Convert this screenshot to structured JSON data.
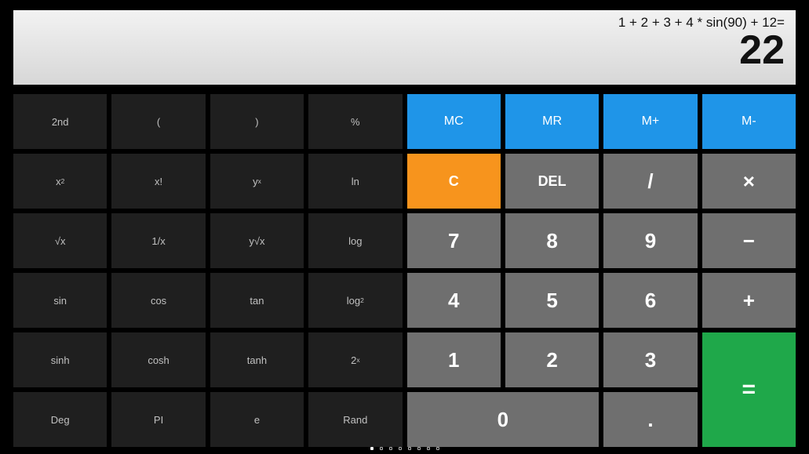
{
  "display": {
    "expression": "1 + 2 + 3 + 4 * sin(90) + 12=",
    "result": "22"
  },
  "buttons": {
    "r1": {
      "second": "2nd",
      "lparen": "(",
      "rparen": ")",
      "percent": "%",
      "mc": "MC",
      "mr": "MR",
      "mplus": "M+",
      "mminus": "M-"
    },
    "r2": {
      "xsq_base": "x",
      "xsq_exp": "2",
      "fact": "x!",
      "ypowx_base": "y",
      "ypowx_exp": "x",
      "ln": "ln",
      "c": "C",
      "del": "DEL",
      "div": "/",
      "mult": "×"
    },
    "r3": {
      "sqrt": "√x",
      "inv": "1/x",
      "yrootx": "y√x",
      "log": "log",
      "n7": "7",
      "n8": "8",
      "n9": "9",
      "minus": "−"
    },
    "r4": {
      "sin": "sin",
      "cos": "cos",
      "tan": "tan",
      "log2_base": "log",
      "log2_sub": "2",
      "n4": "4",
      "n5": "5",
      "n6": "6",
      "plus": "+"
    },
    "r5": {
      "sinh": "sinh",
      "cosh": "cosh",
      "tanh": "tanh",
      "twox_base": "2",
      "twox_exp": "x",
      "n1": "1",
      "n2": "2",
      "n3": "3"
    },
    "r6": {
      "deg": "Deg",
      "pi": "PI",
      "e": "e",
      "rand": "Rand",
      "n0": "0",
      "dot": ".",
      "eq": "="
    }
  },
  "pager": {
    "count": 8,
    "active": 0
  }
}
